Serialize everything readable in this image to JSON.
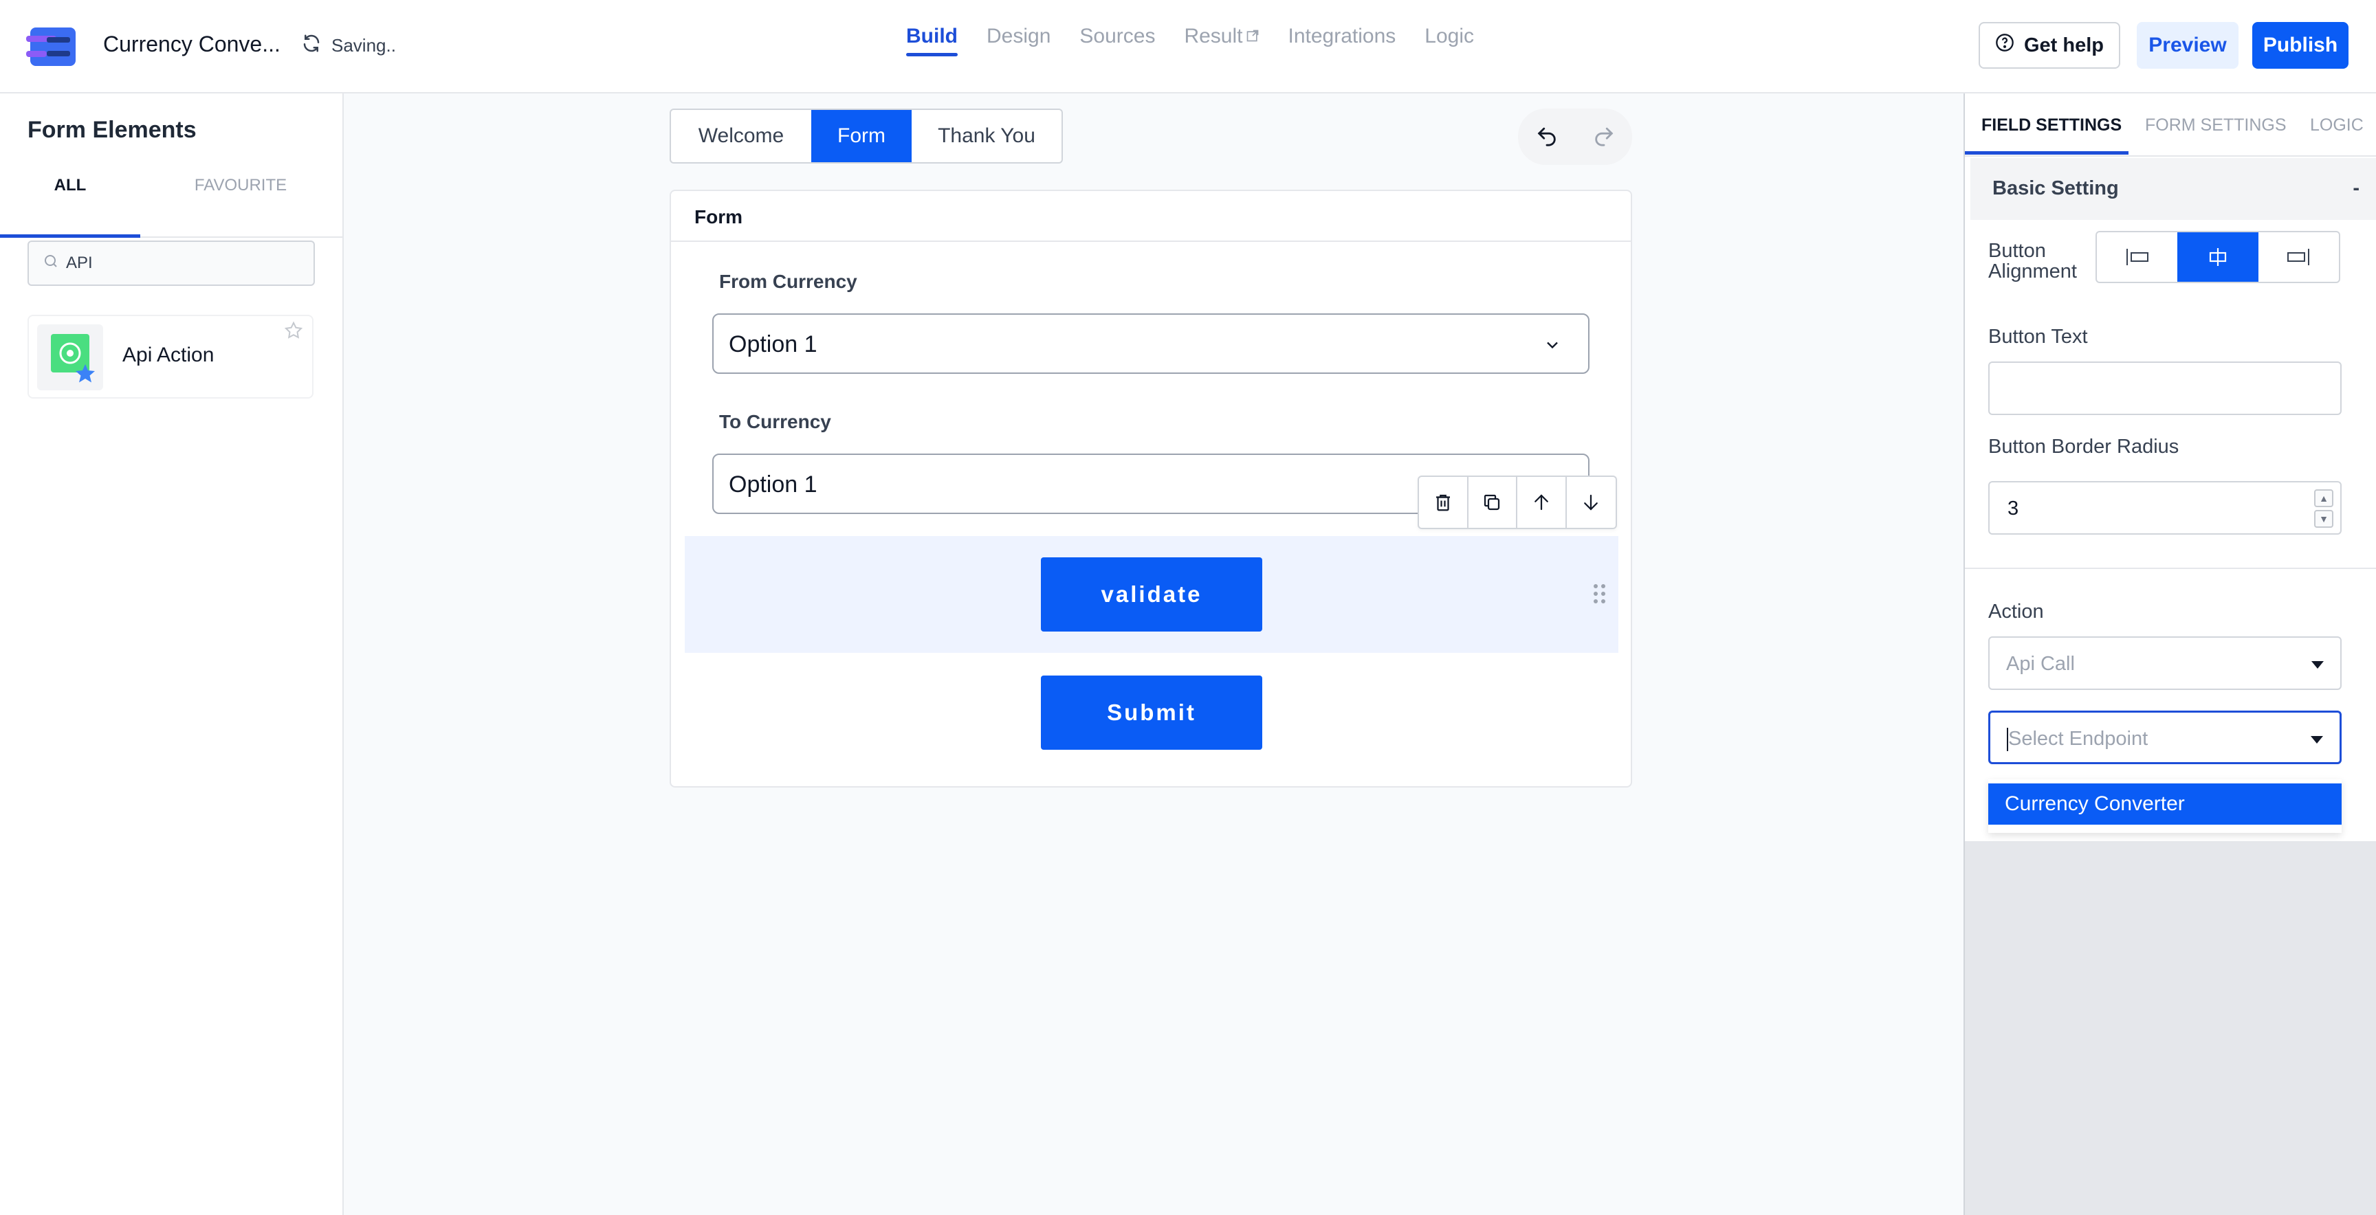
{
  "header": {
    "title": "Currency Conve...",
    "saving_text": "Saving..",
    "nav": [
      {
        "label": "Build"
      },
      {
        "label": "Design"
      },
      {
        "label": "Sources"
      },
      {
        "label": "Result"
      },
      {
        "label": "Integrations"
      },
      {
        "label": "Logic"
      }
    ],
    "help_label": "Get help",
    "preview_label": "Preview",
    "publish_label": "Publish"
  },
  "sidebar": {
    "title": "Form Elements",
    "tabs": [
      "ALL",
      "FAVOURITE"
    ],
    "search_value": "API",
    "items": [
      {
        "label": "Api Action"
      }
    ]
  },
  "canvas": {
    "segments": [
      "Welcome",
      "Form",
      "Thank You"
    ],
    "form_header": "Form",
    "fields": [
      {
        "label": "From Currency",
        "value": "Option 1"
      },
      {
        "label": "To Currency",
        "value": "Option 1"
      }
    ],
    "buttons": [
      "validate",
      "Submit"
    ]
  },
  "right_panel": {
    "tabs": [
      "FIELD SETTINGS",
      "FORM SETTINGS",
      "LOGIC"
    ],
    "section_title": "Basic Setting",
    "collapse_symbol": "-",
    "alignment_label": "Button Alignment",
    "button_text_label": "Button Text",
    "button_text_value": "",
    "border_radius_label": "Button Border Radius",
    "border_radius_value": "3",
    "action_label": "Action",
    "action_value": "Api Call",
    "endpoint_placeholder": "Select Endpoint",
    "endpoint_options": [
      "Currency Converter"
    ]
  },
  "colors": {
    "primary": "#0a5cf5",
    "accent_text": "#1d4ed8",
    "selected_bg": "#eef3ff"
  }
}
